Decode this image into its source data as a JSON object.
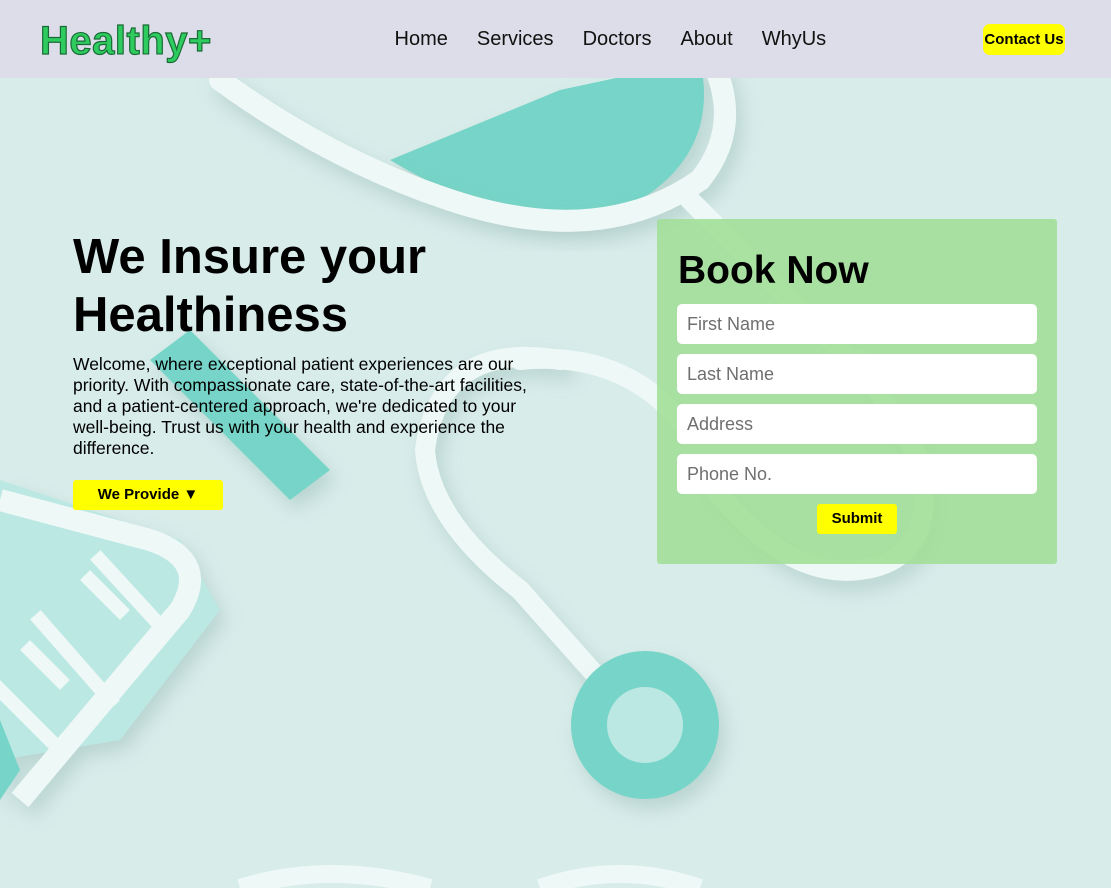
{
  "header": {
    "logo": "Healthy+",
    "nav": [
      "Home",
      "Services",
      "Doctors",
      "About",
      "WhyUs"
    ],
    "contact_label": "Contact Us"
  },
  "hero": {
    "title_line1": "We Insure your",
    "title_line2": "Healthiness",
    "text": "Welcome, where exceptional patient experiences are our priority. With compassionate care, state-of-the-art facilities, and a patient-centered approach, we're dedicated to your well-being. Trust us with your health and experience the difference.",
    "provide_label": "We Provide ▼"
  },
  "booking": {
    "title": "Book Now",
    "fields": [
      {
        "placeholder": "First Name"
      },
      {
        "placeholder": "Last Name"
      },
      {
        "placeholder": "Address"
      },
      {
        "placeholder": "Phone No."
      }
    ],
    "submit_label": "Submit"
  },
  "colors": {
    "accent": "#ffff00",
    "brand": "#2ecc5f",
    "nav_bg": "#dcdde9",
    "page_bg": "#d8ecea",
    "panel_bg": "#a6dea0",
    "illustration": "#76d5c8"
  },
  "background_art": {
    "icon": "stethoscope-and-syringe-illustration"
  }
}
